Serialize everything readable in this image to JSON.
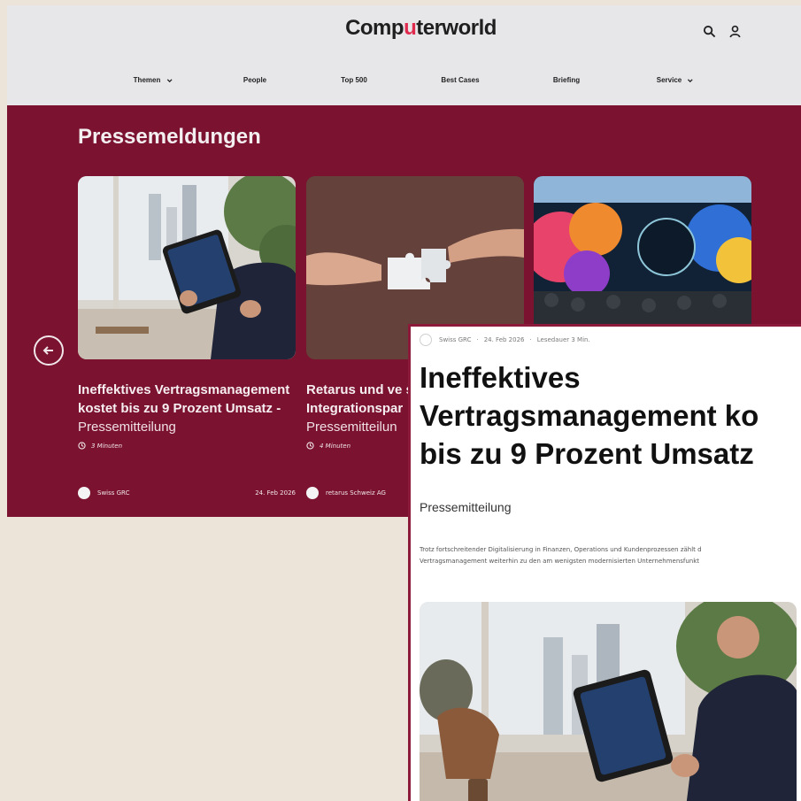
{
  "header": {
    "logo_prefix": "Comp",
    "logo_dot_letter": "u",
    "logo_suffix": "terworld",
    "icons": [
      "search-icon",
      "user-icon"
    ]
  },
  "nav": {
    "items": [
      {
        "label": "Themen",
        "has_dropdown": true
      },
      {
        "label": "People",
        "has_dropdown": false
      },
      {
        "label": "Top 500",
        "has_dropdown": false
      },
      {
        "label": "Best Cases",
        "has_dropdown": false
      },
      {
        "label": "Briefing",
        "has_dropdown": false
      },
      {
        "label": "Service",
        "has_dropdown": true
      }
    ]
  },
  "section": {
    "title": "Pressemeldungen"
  },
  "cards": [
    {
      "title": "Ineffektives Vertragsmanagement kostet bis zu 9 Prozent Umsatz -",
      "subtitle": "Pressemitteilung",
      "read_time": "3 Minuten",
      "author": "Swiss GRC",
      "date": "24. Feb 2026"
    },
    {
      "title": "Retarus und ve schliessen Integrationspar",
      "subtitle": "Pressemitteilun",
      "read_time": "4 Minuten",
      "author": "retarus Schweiz AG",
      "date": ""
    },
    {
      "title": "",
      "subtitle": "",
      "read_time": "",
      "author": "",
      "date": ""
    }
  ],
  "article": {
    "author": "Swiss GRC",
    "date": "24. Feb 2026",
    "read_time": "Lesedauer 3 Min.",
    "title_lines": [
      "Ineffektives",
      "Vertragsmanagement ko",
      "bis zu 9 Prozent Umsatz"
    ],
    "subtitle": "Pressemitteilung",
    "body_lines": [
      "Trotz fortschreitender Digitalisierung in Finanzen, Operations und Kundenprozessen zählt d",
      "Vertragsmanagement weiterhin zu den am wenigsten modernisierten Unternehmensfunkt"
    ]
  },
  "colors": {
    "brand_maroon": "#7a1230",
    "header_bg": "#e7e6e9",
    "page_bg": "#ece4d8",
    "logo_accent": "#e02a4e"
  }
}
